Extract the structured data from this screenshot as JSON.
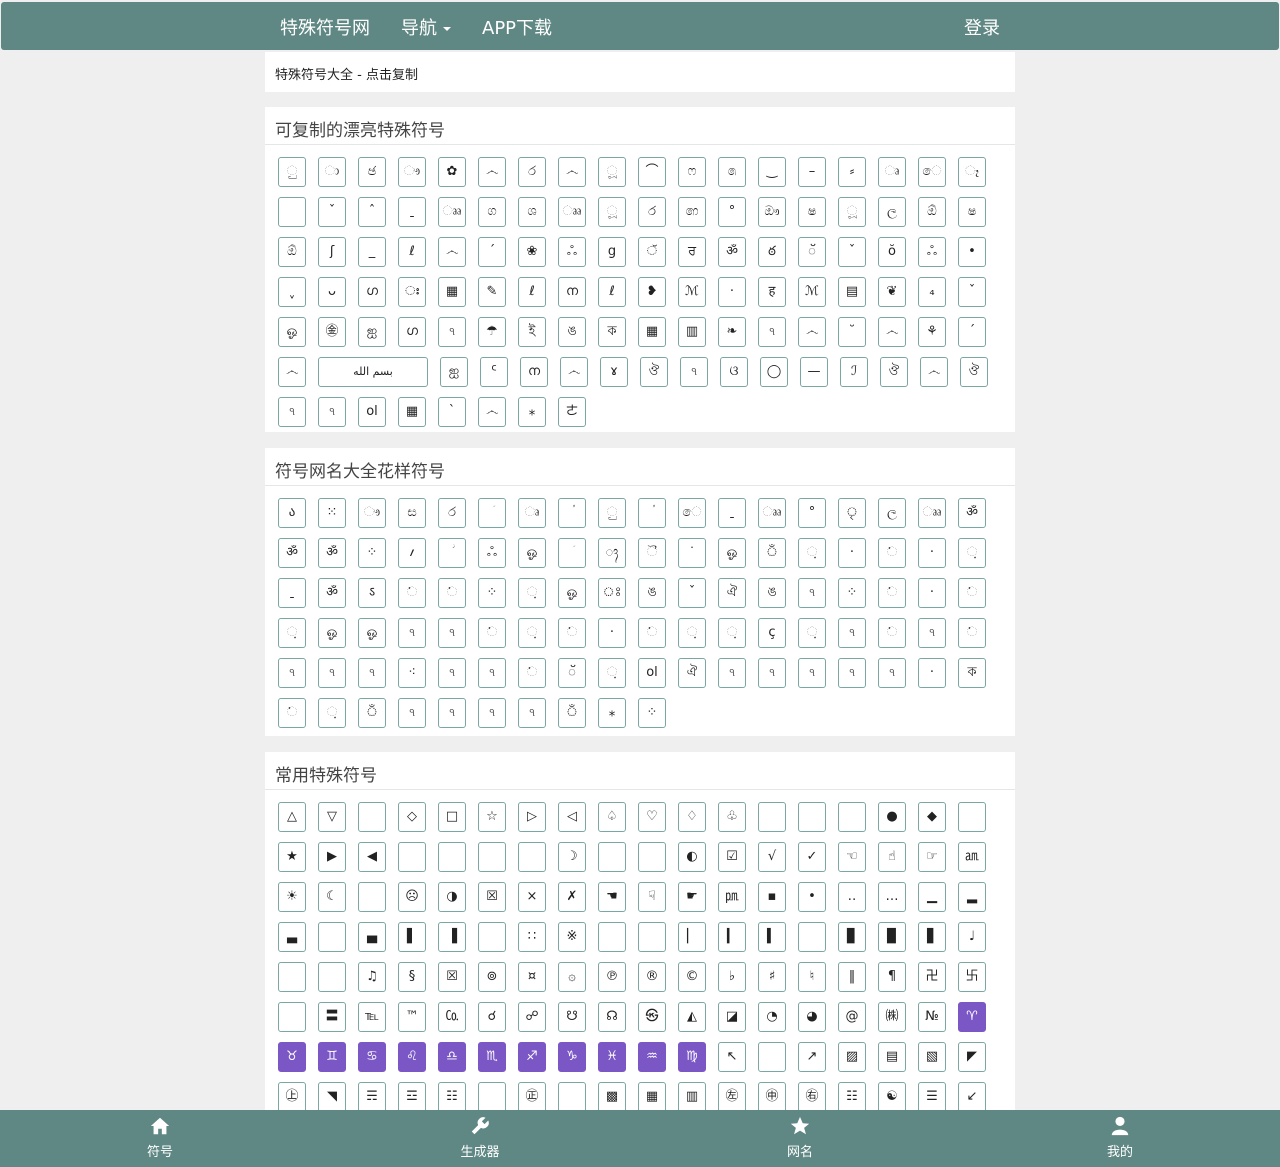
{
  "nav": {
    "brand": "特殊符号网",
    "menu": "导航",
    "app": "APP下载",
    "login": "登录"
  },
  "breadcrumb": "特殊符号大全 - 点击复制",
  "sections": [
    {
      "title": "可复制的漂亮特殊符号",
      "symbols": [
        "ු",
        "ා",
        "ඡ",
        "ෟ",
        "✿",
        "෴",
        "ර",
        "෴",
        "ූ",
        "⌒",
        "ෆ",
        "෧",
        "‿",
        "–",
        "⸗",
        "ෘ",
        "ෙ",
        "ෑ",
        "",
        "ˇ",
        "ˆ",
        "ˍ",
        "ෲ",
        "ග",
        "ශ",
        "ෲ",
        "ූ",
        "෮",
        "෨",
        "°",
        "ඖ",
        "ෂ",
        "ූ",
        "ල",
        "ඕ",
        "ෂ",
        "ඕ",
        "ʃ",
        "_",
        "ℓ",
        "෴",
        "ˊ",
        "❀",
        "ஃ",
        "ց",
        "ੱ",
        "ਰ",
        "ॐ",
        "ఠ",
        "ॅ",
        "ˇ",
        "ŏ",
        "ஃ",
        "•",
        "ˬ",
        "ᴗ",
        "ഗ",
        "ഃ",
        "▦",
        "✎",
        "ℓ",
        "ന",
        "ℓ",
        "❥",
        "ℳ",
        "·",
        "ह",
        "ℳ",
        "▤",
        "❦",
        "₄",
        "ˇ",
        "ஓ",
        "㊎",
        "ஐ",
        "ഗ",
        "ঀ",
        "☂",
        "ই",
        "ঙ",
        "ক",
        "▦",
        "▥",
        "❧",
        "ঀ",
        "෴",
        "˘",
        "෴",
        "⚘",
        "ˊ",
        "෴",
        "بسم الله",
        "ஐ",
        "ᑦ",
        "ന",
        "෴",
        "ɤ",
        "ঔ",
        "ঀ",
        "ଓ",
        "◯",
        "—",
        "ℐ",
        "ঔ",
        "෴",
        "ঔ",
        "ঀ",
        "ঀ",
        "ol",
        "▦",
        "ˋ",
        "෴",
        "⁎",
        "ㄜ"
      ]
    },
    {
      "title": "符号网名大全花样符号",
      "symbols": [
        "ა",
        "⁙",
        "ෟ",
        "ස",
        "ර",
        "ؘ",
        "ෘ",
        "ؙ",
        "ු",
        "ؙ",
        "ෙ",
        "ˍ",
        "ෲ",
        "°",
        "ৃ",
        "ල",
        "ෲ",
        "ॐ",
        "ॐ",
        "ॐ",
        "⁘",
        "؍",
        "ؗ",
        "ஃ",
        "ஓ",
        "ؘ",
        "ᬄ",
        "ୖ",
        "ᣟ",
        "ஓ",
        "ঁ",
        "ᨘ",
        "·",
        "ᨗ",
        "·",
        "ᨘ",
        "ˍ",
        "ॐ",
        "ऽ",
        "ᨗ",
        "ᨗ",
        "⁘",
        "ᨘ",
        "ஓ",
        "ঃ",
        "ঙ",
        "ˇ",
        "ঐ",
        "ঙ",
        "ঀ",
        "⁘",
        "ᨗ",
        "·",
        "ᨗ",
        "ᨘ",
        "ஓ",
        "ஓ",
        "ঀ",
        "ঀ",
        "ᨗ",
        "ᨘ",
        "ᨗ",
        "·",
        "ᨗ",
        "ᨘ",
        "ᨘ",
        "ҫ",
        "ᨘ",
        "ঀ",
        "ᨗ",
        "ঀ",
        "ᨗ",
        "ঀ",
        "ঀ",
        "ঀ",
        "⁖",
        "ঀ",
        "ঀ",
        "ᨗ",
        "ॅ",
        "ᨘ",
        "ol",
        "ঐ",
        "ঀ",
        "ঀ",
        "ঀ",
        "ঀ",
        "ঀ",
        "·",
        "ক",
        "ᨗ",
        "ᨘ",
        "ঁ",
        "ঀ",
        "ঀ",
        "ঀ",
        "ঀ",
        "ঁ",
        "⁎",
        "⁘"
      ]
    },
    {
      "title": "常用特殊符号",
      "symbols": [
        "△",
        "▽",
        "",
        "◇",
        "□",
        "☆",
        "▷",
        "◁",
        "♤",
        "♡",
        "♢",
        "♧",
        "",
        "",
        "",
        "●",
        "◆",
        "",
        "★",
        "▶",
        "◀",
        "",
        "",
        "",
        "",
        "☽",
        "",
        "",
        "◐",
        "☑",
        "√",
        "✓",
        "☜",
        "☝",
        "☞",
        "㏂",
        "☀",
        "☾",
        "",
        "☹",
        "◑",
        "☒",
        "×",
        "✗",
        "☚",
        "☟",
        "☛",
        "㏘",
        "▪",
        "•",
        "‥",
        "…",
        "▁",
        "▂",
        "▃",
        "",
        "▄",
        "▌",
        "▐",
        "",
        "∷",
        "※",
        "",
        "",
        "▏",
        "▎",
        "▍",
        "",
        "▊",
        "▉",
        "▋",
        "♩",
        "",
        "",
        "♫",
        "§",
        "☒",
        "⊚",
        "¤",
        "۞",
        "℗",
        "®",
        "©",
        "♭",
        "♯",
        "♮",
        "‖",
        "¶",
        "卍",
        "卐",
        "",
        "〓",
        "℡",
        "™",
        "㏇",
        "☌",
        "☍",
        "☋",
        "☊",
        "㉿",
        "◭",
        "◪",
        "◔",
        "◕",
        "@",
        "㈱",
        "№",
        "♈",
        "♉",
        "♊",
        "♋",
        "♌",
        "♎",
        "♏",
        "♐",
        "♑",
        "♓",
        "♒",
        "♍",
        "↖",
        "",
        "↗",
        "▨",
        "▤",
        "▧",
        "◤",
        "㊤",
        "◥",
        "☴",
        "☲",
        "☷",
        "",
        "㊣",
        "",
        "▩",
        "▦",
        "▥",
        "㊧",
        "㊥",
        "㊨",
        "☷",
        "☯",
        "☰",
        "↙",
        "",
        "↘",
        "▫",
        "◈"
      ]
    }
  ],
  "bottom_tabs": [
    {
      "label": "符号",
      "icon": "home-icon"
    },
    {
      "label": "生成器",
      "icon": "wrench-icon"
    },
    {
      "label": "网名",
      "icon": "star-icon"
    },
    {
      "label": "我的",
      "icon": "user-icon"
    }
  ],
  "colors": {
    "brand": "#5f8784",
    "zodiac": "#7b57c6"
  }
}
